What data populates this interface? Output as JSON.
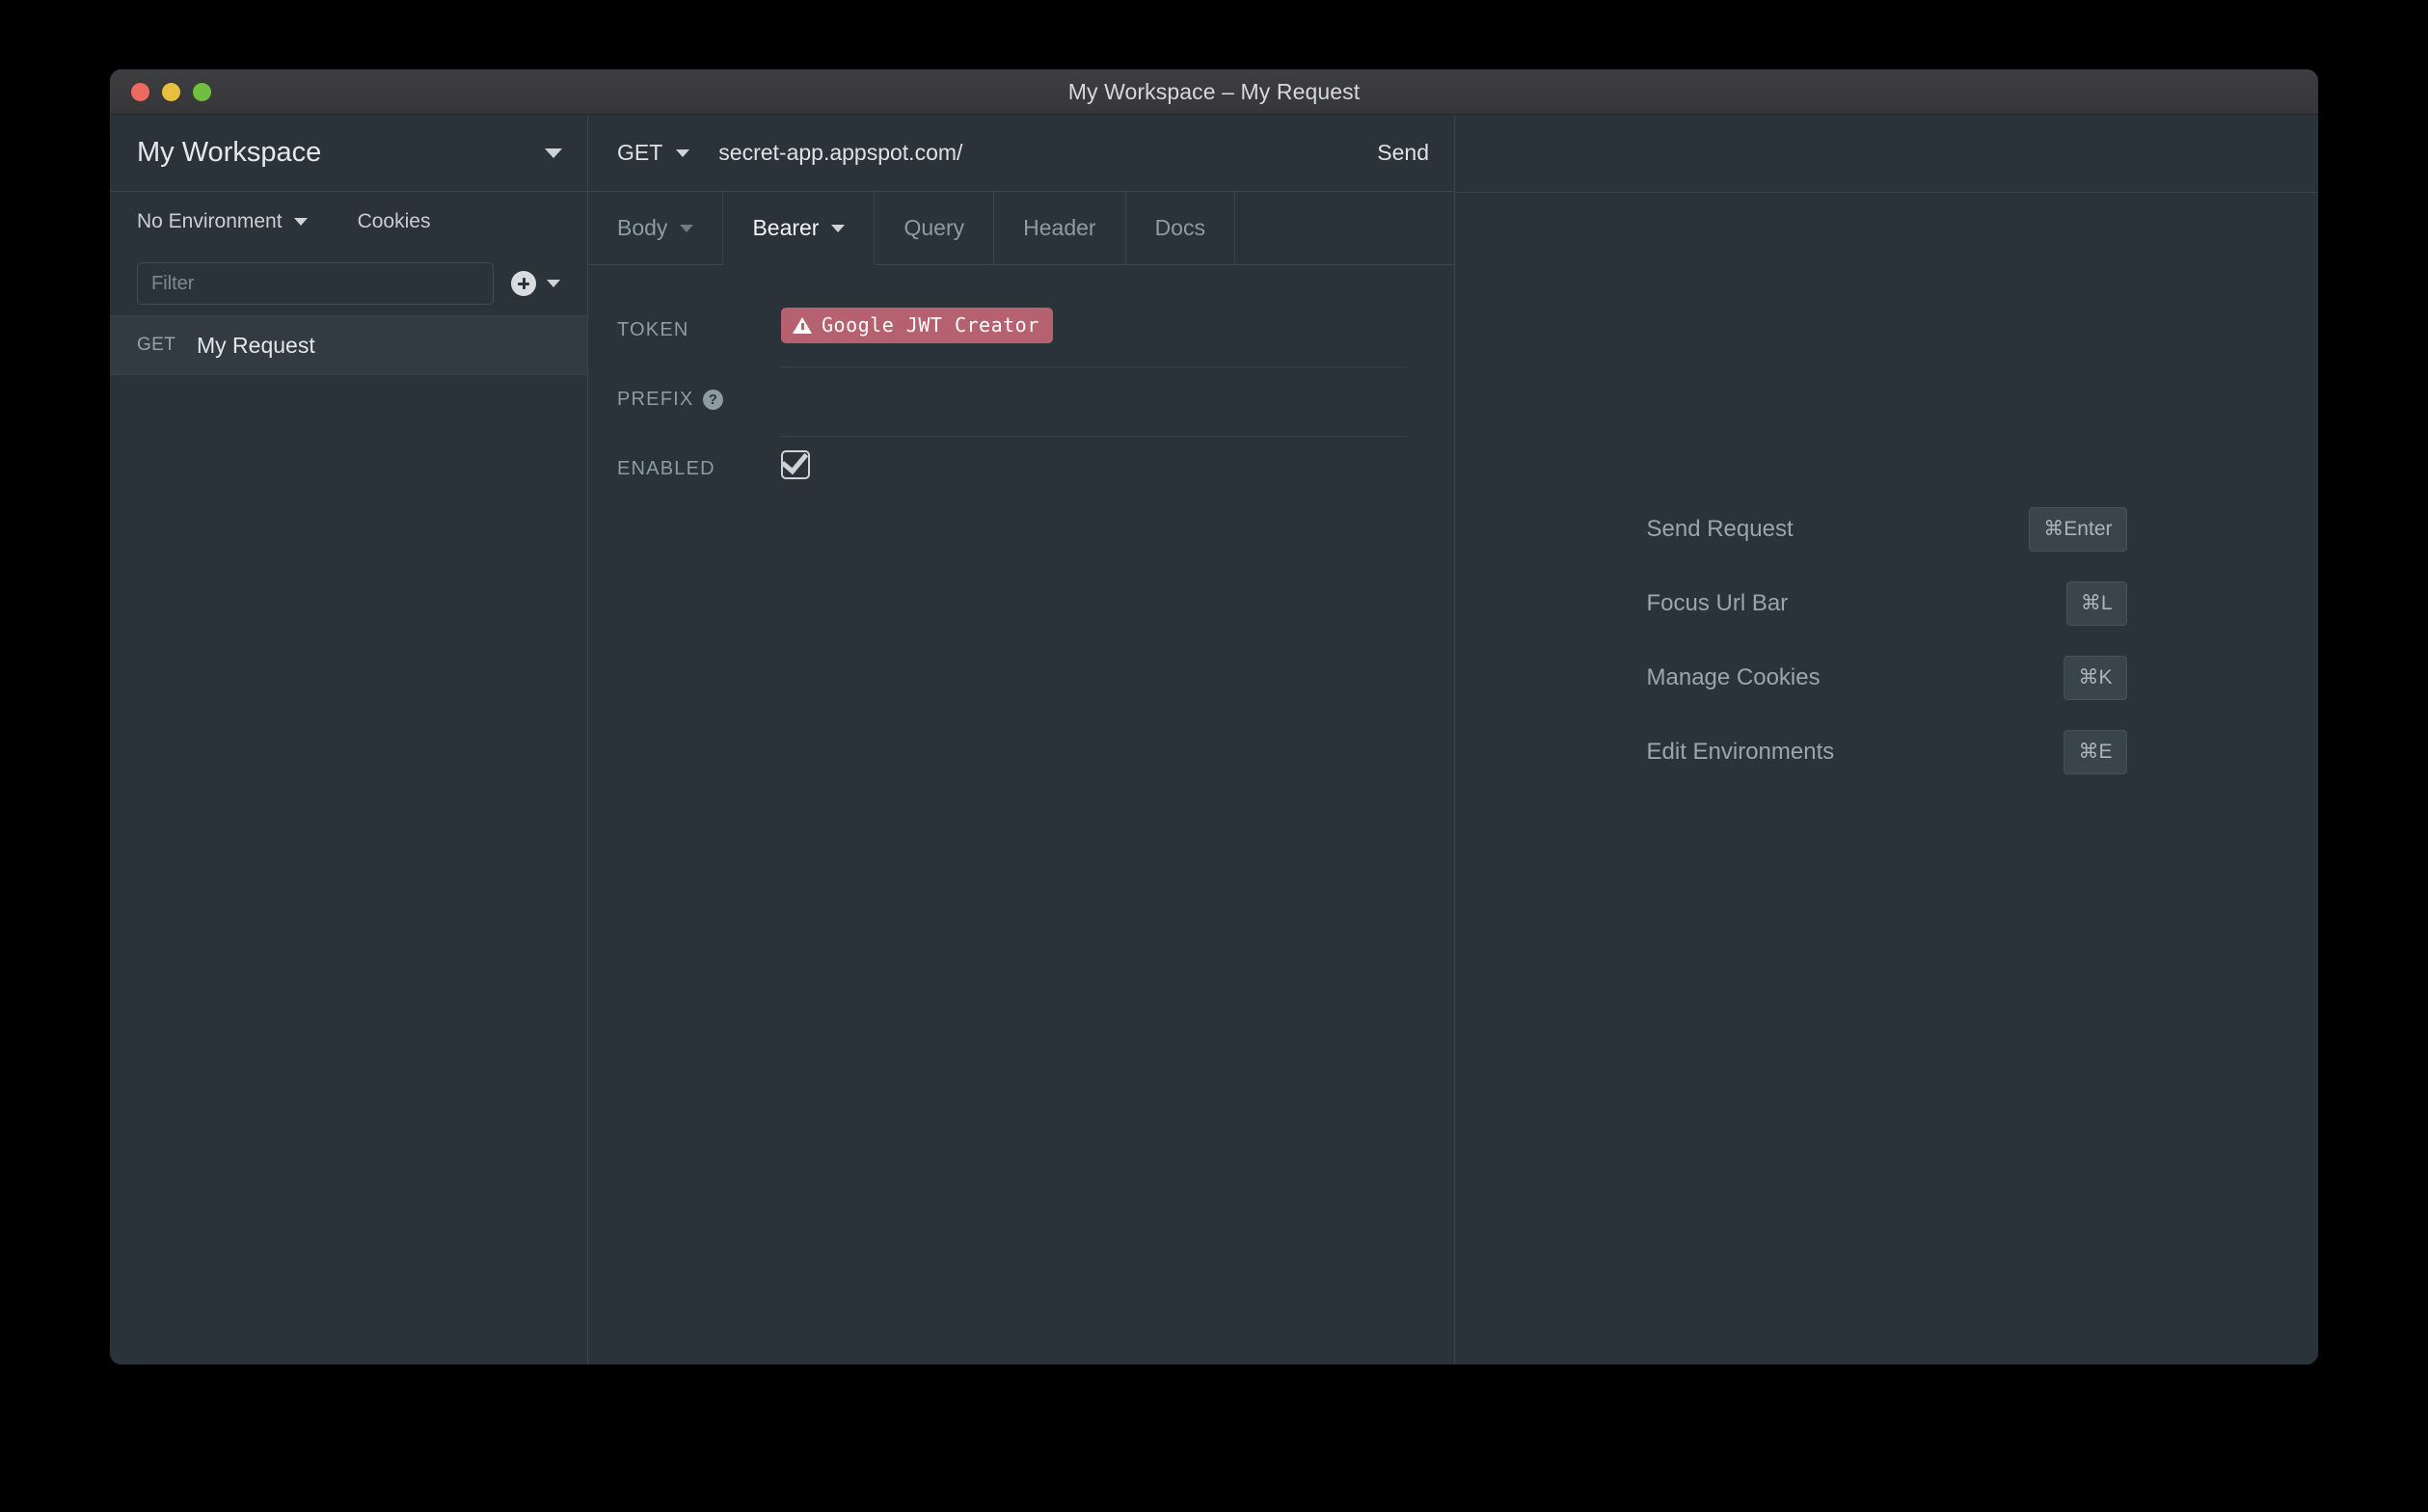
{
  "window": {
    "title": "My Workspace – My Request",
    "traffic_lights": [
      "close",
      "minimize",
      "zoom"
    ]
  },
  "sidebar": {
    "workspace_name": "My Workspace",
    "environment": "No Environment",
    "cookies_label": "Cookies",
    "filter_placeholder": "Filter",
    "filter_value": "",
    "requests": [
      {
        "method": "GET",
        "name": "My Request"
      }
    ]
  },
  "request": {
    "method": "GET",
    "url": "secret-app.appspot.com/",
    "send_label": "Send",
    "tabs": [
      {
        "label": "Body",
        "active": false,
        "has_caret": true
      },
      {
        "label": "Bearer",
        "active": true,
        "has_caret": true
      },
      {
        "label": "Query",
        "active": false,
        "has_caret": false
      },
      {
        "label": "Header",
        "active": false,
        "has_caret": false
      },
      {
        "label": "Docs",
        "active": false,
        "has_caret": false
      }
    ],
    "auth": {
      "token_label": "TOKEN",
      "token_badge": "Google JWT Creator",
      "prefix_label": "PREFIX",
      "prefix_value": "",
      "enabled_label": "ENABLED",
      "enabled": true
    }
  },
  "response": {
    "shortcuts": [
      {
        "label": "Send Request",
        "keys": "⌘Enter"
      },
      {
        "label": "Focus Url Bar",
        "keys": "⌘L"
      },
      {
        "label": "Manage Cookies",
        "keys": "⌘K"
      },
      {
        "label": "Edit Environments",
        "keys": "⌘E"
      }
    ]
  },
  "colors": {
    "app_background": "#2b333a",
    "titlebar": "#3a3a3c",
    "border": "#3a444b",
    "badge_danger": "#b5616f",
    "text_primary": "#e3e6e8",
    "text_muted": "#8d9ba2"
  }
}
